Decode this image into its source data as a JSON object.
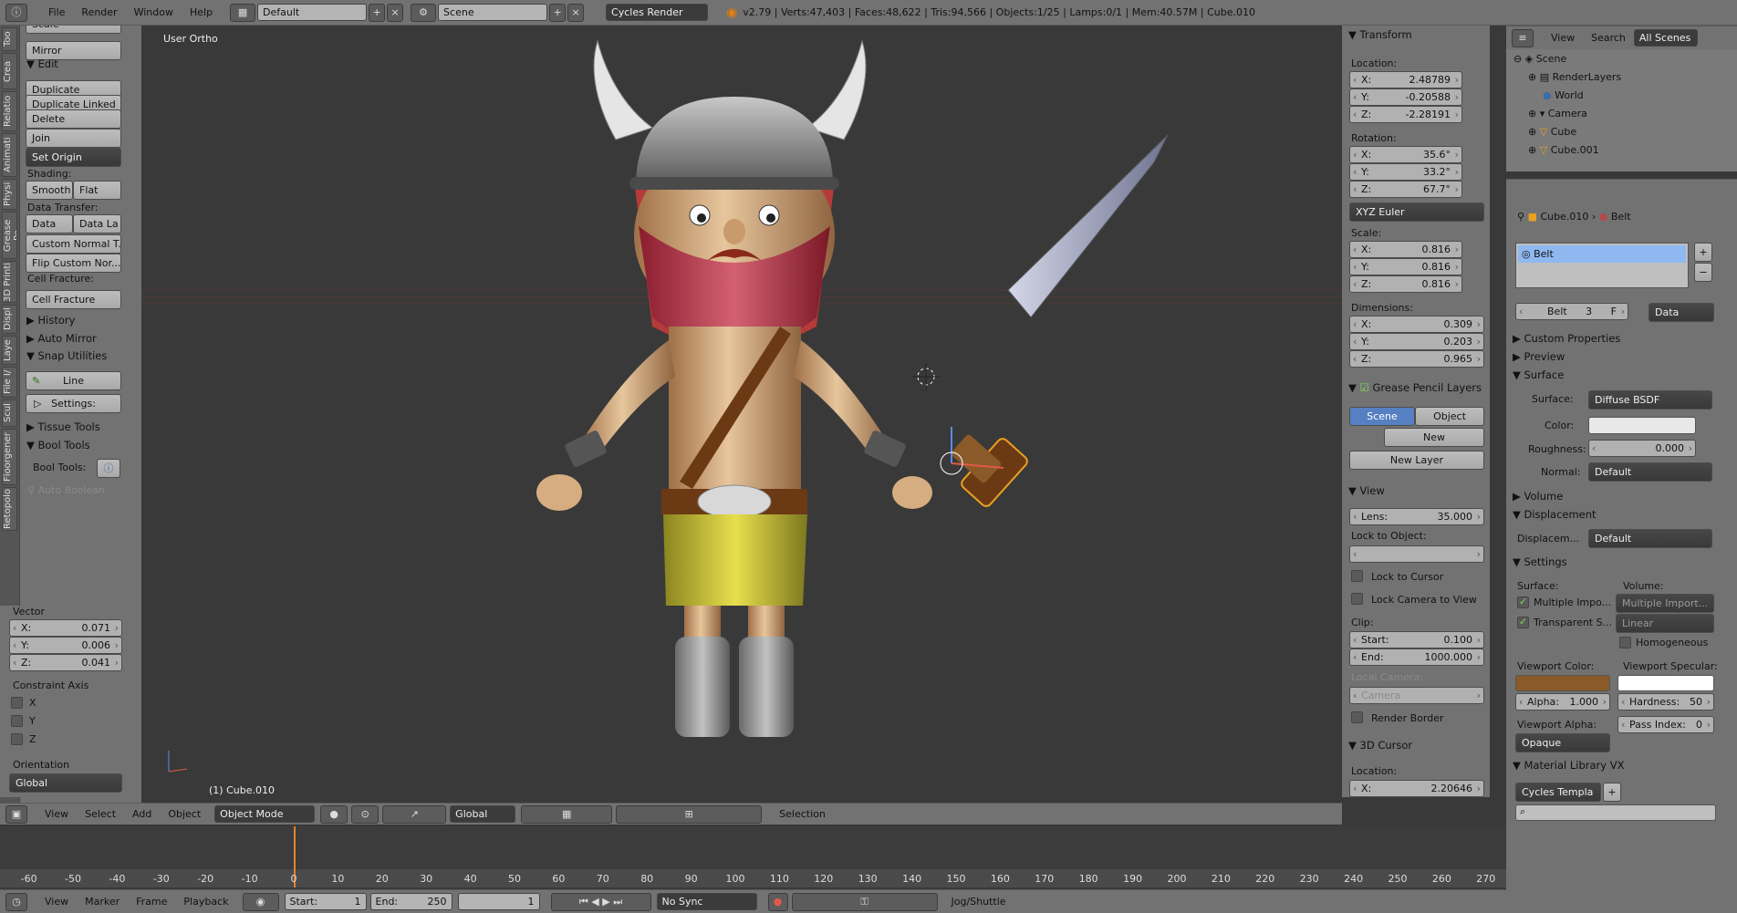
{
  "topbar": {
    "menus": [
      "File",
      "Render",
      "Window",
      "Help"
    ],
    "layout": "Default",
    "scene": "Scene",
    "engine": "Cycles Render",
    "info": "v2.79 | Verts:47,403 | Faces:48,622 | Tris:94,566 | Objects:1/25 | Lamps:0/1 | Mem:40.57M | Cube.010"
  },
  "left_tabs": [
    "Too",
    "Crea",
    "Relatio",
    "Animati",
    "Physi",
    "Grease Pe",
    "3D Printi",
    "Displ",
    "Laye",
    "File I/",
    "Scul",
    "Floorgener",
    "Retopolo"
  ],
  "toolshelf": {
    "scale_label": "Scale",
    "mirror": "Mirror",
    "edit_header": "Edit",
    "duplicate": "Duplicate",
    "duplicate_linked": "Duplicate Linked",
    "delete": "Delete",
    "join": "Join",
    "set_origin": "Set Origin",
    "shading_label": "Shading:",
    "smooth": "Smooth",
    "flat": "Flat",
    "data_transfer_label": "Data Transfer:",
    "data": "Data",
    "data_la": "Data La",
    "custom_normal": "Custom Normal T...",
    "flip_custom": "Flip Custom Nor...",
    "cell_fracture_label": "Cell Fracture:",
    "cell_fracture": "Cell Fracture",
    "history": "History",
    "auto_mirror": "Auto Mirror",
    "snap_utilities": "Snap Utilities",
    "line": "Line",
    "settings": "Settings:",
    "tissue_tools": "Tissue Tools",
    "bool_tools": "Bool Tools",
    "bool_tools_label": "Bool Tools:",
    "auto_boolean": "Auto Boolean"
  },
  "operator": {
    "vector_label": "Vector",
    "x_label": "X:",
    "x": "0.071",
    "y_label": "Y:",
    "y": "0.006",
    "z_label": "Z:",
    "z": "0.041",
    "constraint_label": "Constraint Axis",
    "axes": [
      "X",
      "Y",
      "Z"
    ],
    "orientation_label": "Orientation",
    "orientation": "Global"
  },
  "viewport": {
    "view_name": "User Ortho",
    "object_label": "(1) Cube.010"
  },
  "npanel": {
    "transform": "Transform",
    "location": "Location:",
    "loc": [
      [
        "X:",
        "2.48789"
      ],
      [
        "Y:",
        "-0.20588"
      ],
      [
        "Z:",
        "-2.28191"
      ]
    ],
    "rotation": "Rotation:",
    "rot": [
      [
        "X:",
        "35.6°"
      ],
      [
        "Y:",
        "33.2°"
      ],
      [
        "Z:",
        "67.7°"
      ]
    ],
    "euler": "XYZ Euler",
    "scale": "Scale:",
    "scl": [
      [
        "X:",
        "0.816"
      ],
      [
        "Y:",
        "0.816"
      ],
      [
        "Z:",
        "0.816"
      ]
    ],
    "dimensions": "Dimensions:",
    "dim": [
      [
        "X:",
        "0.309"
      ],
      [
        "Y:",
        "0.203"
      ],
      [
        "Z:",
        "0.965"
      ]
    ],
    "grease_pencil": "Grease Pencil Layers",
    "scene_btn": "Scene",
    "object_btn": "Object",
    "new_btn": "New",
    "new_layer": "New Layer",
    "view": "View",
    "lens_label": "Lens:",
    "lens": "35.000",
    "lock_to_object": "Lock to Object:",
    "lock_to_cursor": "Lock to Cursor",
    "lock_camera": "Lock Camera to View",
    "clip": "Clip:",
    "start_label": "Start:",
    "start": "0.100",
    "end_label": "End:",
    "end": "1000.000",
    "local_camera": "Local Camera:",
    "camera": "Camera",
    "render_border": "Render Border",
    "cursor": "3D Cursor",
    "cursor_location": "Location:",
    "cursor_x_label": "X:",
    "cursor_x": "2.20646"
  },
  "outliner": {
    "view": "View",
    "search": "Search",
    "all_scenes": "All Scenes",
    "items": [
      "Scene",
      "RenderLayers",
      "World",
      "Camera",
      "Cube",
      "Cube.001"
    ]
  },
  "properties": {
    "breadcrumb_obj": "Cube.010",
    "breadcrumb_mat": "Belt",
    "slot": "Belt",
    "mat_name": "Belt",
    "users": "3",
    "fake": "F",
    "data": "Data",
    "custom_properties": "Custom Properties",
    "preview": "Preview",
    "surface_header": "Surface",
    "surface_label": "Surface:",
    "surface_value": "Diffuse BSDF",
    "color_label": "Color:",
    "roughness_label": "Roughness:",
    "roughness": "0.000",
    "normal_label": "Normal:",
    "normal": "Default",
    "volume": "Volume",
    "displacement": "Displacement",
    "displacement_label": "Displacem...",
    "displacement_value": "Default",
    "settings": "Settings",
    "surface_col": "Surface:",
    "volume_col": "Volume:",
    "multiple_importance": "Multiple Impo...",
    "multiple_import_dd": "Multiple Import...",
    "transparent": "Transparent S...",
    "linear": "Linear",
    "homogeneous": "Homogeneous",
    "viewport_color": "Viewport Color:",
    "viewport_specular": "Viewport Specular:",
    "alpha_label": "Alpha:",
    "alpha": "1.000",
    "hardness_label": "Hardness:",
    "hardness": "50",
    "viewport_alpha": "Viewport Alpha:",
    "pass_index_label": "Pass Index:",
    "pass_index": "0",
    "opaque": "Opaque",
    "material_library": "Material Library VX",
    "cycles_templa": "Cycles Templa"
  },
  "view3d_header": {
    "view": "View",
    "select": "Select",
    "add": "Add",
    "object": "Object",
    "mode": "Object Mode",
    "orientation": "Global",
    "selection": "Selection"
  },
  "timeline": {
    "ticks": [
      "-60",
      "-50",
      "-40",
      "-30",
      "-20",
      "-10",
      "0",
      "10",
      "20",
      "30",
      "40",
      "50",
      "60",
      "70",
      "80",
      "90",
      "100",
      "110",
      "120",
      "130",
      "140",
      "150",
      "160",
      "170",
      "180",
      "190",
      "200",
      "210",
      "220",
      "230",
      "240",
      "250",
      "260",
      "270"
    ],
    "view": "View",
    "marker": "Marker",
    "frame": "Frame",
    "playback": "Playback",
    "start_label": "Start:",
    "start": "1",
    "end_label": "End:",
    "end": "250",
    "current": "1",
    "sync": "No Sync",
    "keying": "Jog/Shuttle"
  },
  "colors": {
    "viewport_color": "#8a5a28",
    "viewport_specular": "#ffffff",
    "accent": "#5680c2"
  }
}
